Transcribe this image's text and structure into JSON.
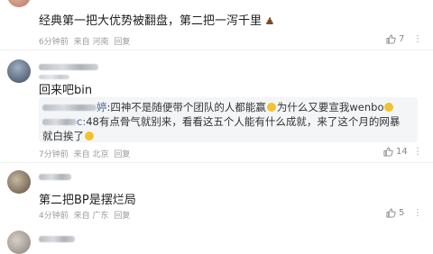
{
  "comments": [
    {
      "text": "经典第一把大优势被翻盘，第二把一泻千里",
      "emoji": "poop-emoji",
      "time": "6分钟前",
      "location": "来自 河南",
      "reply_label": "回复",
      "likes": "7"
    },
    {
      "text": "回来吧bin",
      "time": "7分钟前",
      "location": "来自 北京",
      "reply_label": "回复",
      "likes": "14",
      "quoted_reply": {
        "line1_name_suffix": "婷",
        "line1_text": ":四神不是随便带个团队的人都能赢",
        "line1_text2": "为什么又要宣我wenbo",
        "line2_prefix": "c:",
        "line2_text": "48有点骨气就别来，看看这五个人能有什么成就，来了这个月的网暴",
        "line3_text": "就白挨了"
      }
    },
    {
      "text": "第二把BP是摆烂局",
      "time": "4分钟前",
      "location": "来自 广东",
      "reply_label": "回复",
      "likes": "5"
    }
  ],
  "colors": {
    "text": "#1f1f1f",
    "meta": "#9a9a9a",
    "reply_bg": "#f4f5f7",
    "username_link": "#4f6b9b"
  },
  "icons": {
    "like": "thumb-up-icon",
    "more": "more-options-icon"
  }
}
